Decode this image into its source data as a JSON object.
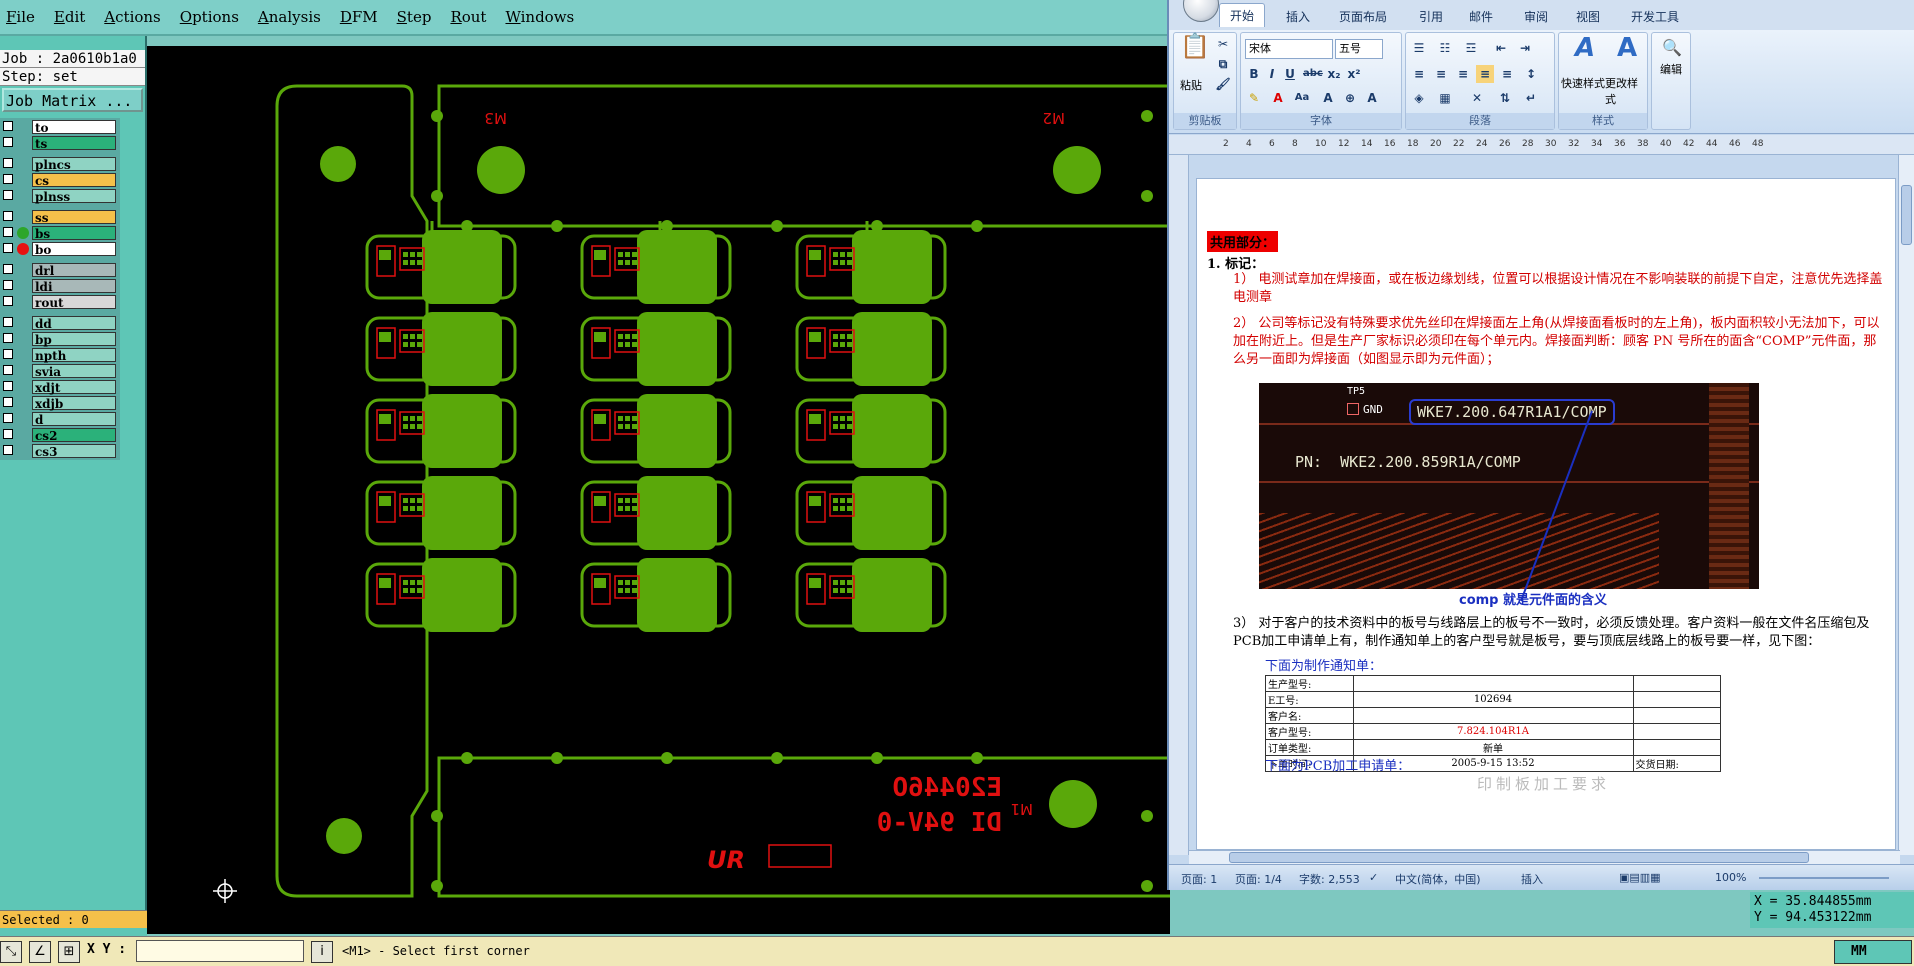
{
  "cam": {
    "menu": [
      "File",
      "Edit",
      "Actions",
      "Options",
      "Analysis",
      "DFM",
      "Step",
      "Rout",
      "Windows"
    ],
    "job_label": "Job : 2a0610b1a0",
    "step_label": "Step: set",
    "job_matrix_button": "Job Matrix ...",
    "layers": [
      {
        "name": "to",
        "color": "#ffffff",
        "dot": ""
      },
      {
        "name": "ts",
        "color": "#2bb17a",
        "dot": ""
      },
      {
        "name": "plncs",
        "color": "#8fd3c3",
        "dot": ""
      },
      {
        "name": "cs",
        "color": "#f5c04a",
        "dot": ""
      },
      {
        "name": "plnss",
        "color": "#8fd3c3",
        "dot": ""
      },
      {
        "name": "ss",
        "color": "#f5c04a",
        "dot": ""
      },
      {
        "name": "bs",
        "color": "#2bb17a",
        "dot": "#2da62b"
      },
      {
        "name": "bo",
        "color": "#ffffff",
        "dot": "#e81010"
      },
      {
        "name": "drl",
        "color": "#a8b8b8",
        "dot": ""
      },
      {
        "name": "ldi",
        "color": "#a8b8b8",
        "dot": ""
      },
      {
        "name": "rout",
        "color": "#d8d8d8",
        "dot": ""
      },
      {
        "name": "dd",
        "color": "#8fd3c3",
        "dot": ""
      },
      {
        "name": "bp",
        "color": "#8fd3c3",
        "dot": ""
      },
      {
        "name": "npth",
        "color": "#8fd3c3",
        "dot": ""
      },
      {
        "name": "svia",
        "color": "#8fd3c3",
        "dot": ""
      },
      {
        "name": "xdjt",
        "color": "#8fd3c3",
        "dot": ""
      },
      {
        "name": "xdjb",
        "color": "#8fd3c3",
        "dot": ""
      },
      {
        "name": "d",
        "color": "#8fd3c3",
        "dot": ""
      },
      {
        "name": "cs2",
        "color": "#2bb17a",
        "dot": ""
      },
      {
        "name": "cs3",
        "color": "#8fd3c3",
        "dot": ""
      }
    ],
    "selected": "Selected : 0",
    "board_marks": {
      "m3": "M3",
      "m2": "M2",
      "m1": "M1",
      "datecode": "E20446O",
      "ul": "DI 94V-0"
    },
    "xy_label": "X Y :",
    "prompt": "<M1> - Select first corner",
    "unit": "MM",
    "coord_x": "X = 35.844855mm",
    "coord_y": "Y = 94.453122mm"
  },
  "word": {
    "tabs": [
      "开始",
      "插入",
      "页面布局",
      "引用",
      "邮件",
      "审阅",
      "视图",
      "开发工具"
    ],
    "font_name": "宋体",
    "font_size": "五号",
    "groups": [
      "剪贴板",
      "字体",
      "段落",
      "样式",
      "编辑"
    ],
    "paste_label": "粘贴",
    "quick_style": "快速样式",
    "change_style": "更改样式",
    "edit_label": "编辑",
    "ruler_ticks": [
      "2",
      "4",
      "6",
      "8",
      "10",
      "12",
      "14",
      "16",
      "18",
      "20",
      "22",
      "24",
      "26",
      "28",
      "30",
      "32",
      "34",
      "36",
      "38",
      "40",
      "42",
      "44",
      "46",
      "48"
    ],
    "doc": {
      "heading": "共用部分：",
      "item1": "1.  标记：",
      "p1": "1） 电测试章加在焊接面，或在板边缘划线，位置可以根据设计情况在不影响装联的前提下自定，注意优先选择盖电测章",
      "p2": "2） 公司等标记没有特殊要求优先丝印在焊接面左上角(从焊接面看板时的左上角)，板内面积较小无法加下，可以加在附近上。但是生产厂家标识必须印在每个单元内。焊接面判断：顾客 PN 号所在的面含“COMP”元件面，那么另一面即为焊接面（如图显示即为元件面）；",
      "img_tp": "TP5",
      "img_gnd": "GND",
      "img_comp": "WKE7.200.647R1A1/COMP",
      "img_pn": "PN:  WKE2.200.859R1A/COMP",
      "caption": "comp 就是元件面的含义",
      "p3": "3） 对于客户的技术资料中的板号与线路层上的板号不一致时，必须反馈处理。客户资料一般在文件名压缩包及PCB加工申请单上有，制作通知单上的客户型号就是板号，要与顶底层线路上的板号要一样，见下图：",
      "notice": "下面为制作通知单：",
      "table": [
        [
          "生产型号:",
          "",
          ""
        ],
        [
          "E工号:",
          "102694",
          ""
        ],
        [
          "客户名:",
          "",
          ""
        ],
        [
          "客户型号:",
          "7.824.104R1A",
          ""
        ],
        [
          "订单类型:",
          "新单",
          ""
        ],
        [
          "下单时间:",
          "2005-9-15 13:52",
          "交货日期:"
        ]
      ],
      "apply": "下面为PCB加工申请单：",
      "apply_title": "印制板加工要求"
    },
    "status": {
      "page": "页面: 1",
      "pages": "页面: 1/4",
      "words": "字数: 2,553",
      "lang": "中文(简体，中国)",
      "mode": "插入",
      "zoom": "100%"
    }
  }
}
